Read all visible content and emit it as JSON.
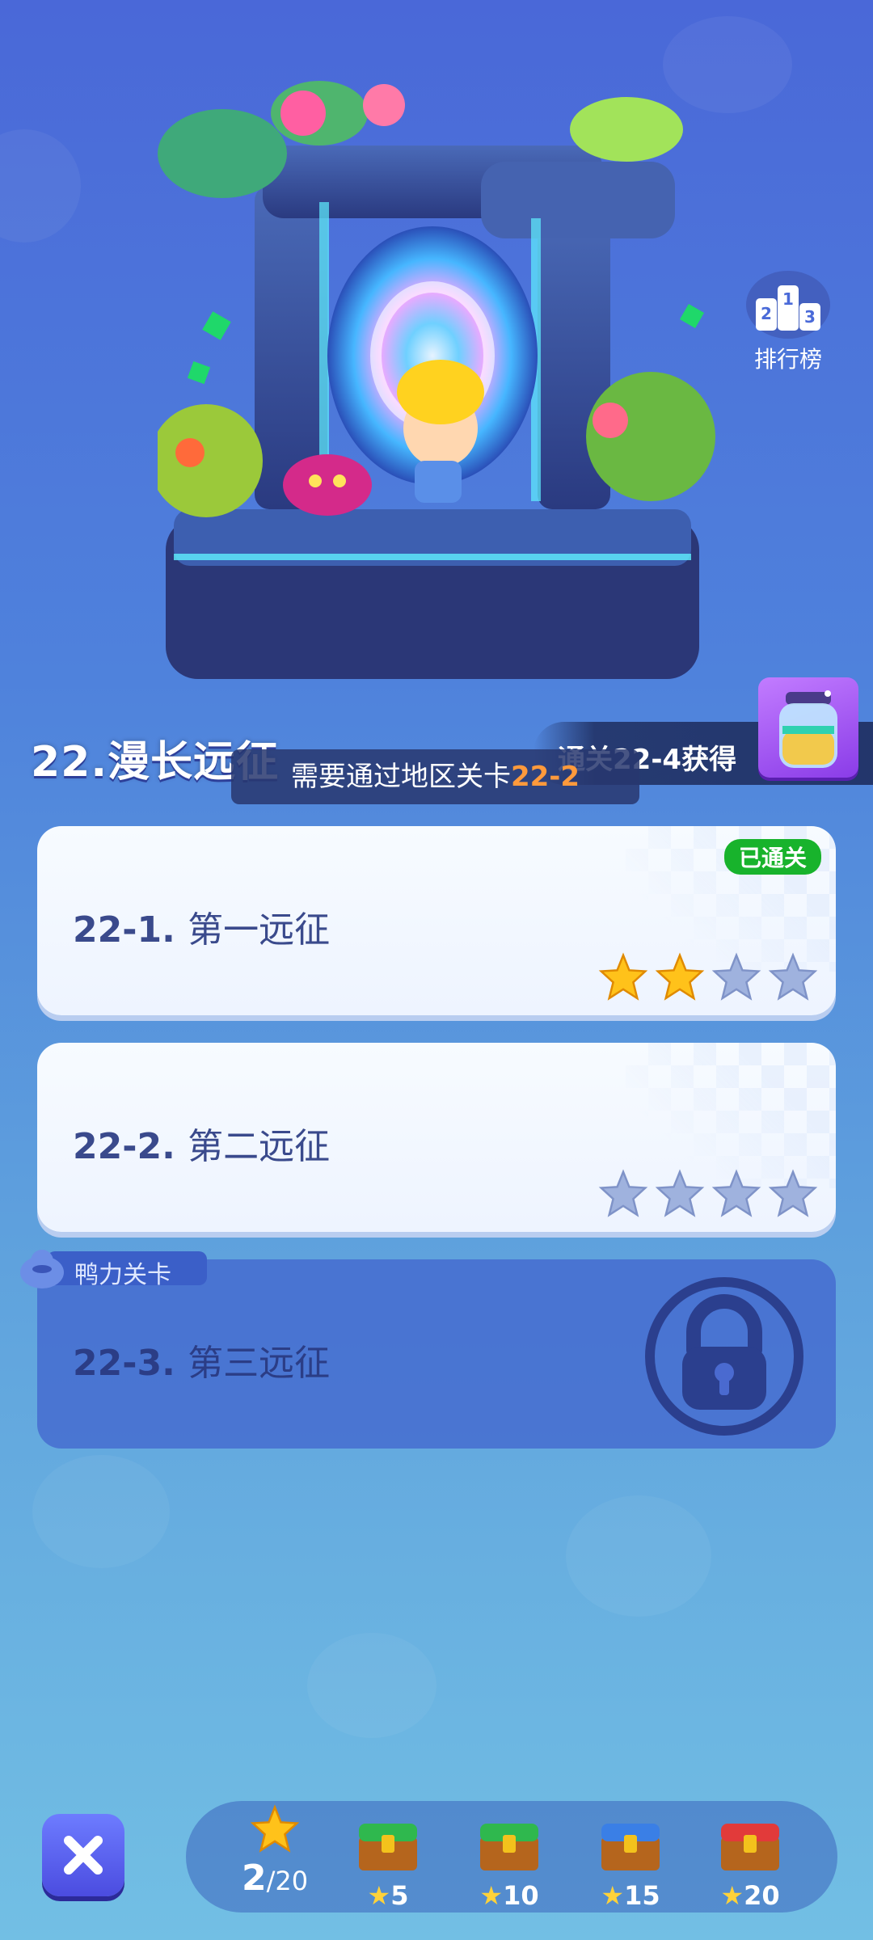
{
  "leaderboard": {
    "label": "排行榜",
    "icon": "podium-icon"
  },
  "chapter": {
    "title": "22.漫长远征"
  },
  "reward": {
    "text": "通关22-4获得",
    "icon": "potion-jar-icon"
  },
  "tooltip": {
    "prefix": "需要通过地区关卡",
    "highlight": "22-2"
  },
  "levels": [
    {
      "code": "22-1.",
      "name": "第一远征",
      "badge": "已通关",
      "stars_earned": 2,
      "stars_total": 4
    },
    {
      "code": "22-2.",
      "name": "第二远征",
      "stars_earned": 0,
      "stars_total": 4
    },
    {
      "code": "22-3.",
      "name": "第三远征",
      "tag": "鸭力关卡",
      "locked": true
    }
  ],
  "progress": {
    "current": "2",
    "total": "/20",
    "milestones": [
      {
        "stars": "5",
        "chest": "green-chest-icon"
      },
      {
        "stars": "10",
        "chest": "green-chest-icon"
      },
      {
        "stars": "15",
        "chest": "blue-chest-icon"
      },
      {
        "stars": "20",
        "chest": "red-chest-icon"
      }
    ]
  },
  "colors": {
    "accent_orange": "#ff9a3c",
    "badge_green": "#18b32c",
    "star_gold": "#ffc21a",
    "star_empty": "#9fb2de"
  }
}
